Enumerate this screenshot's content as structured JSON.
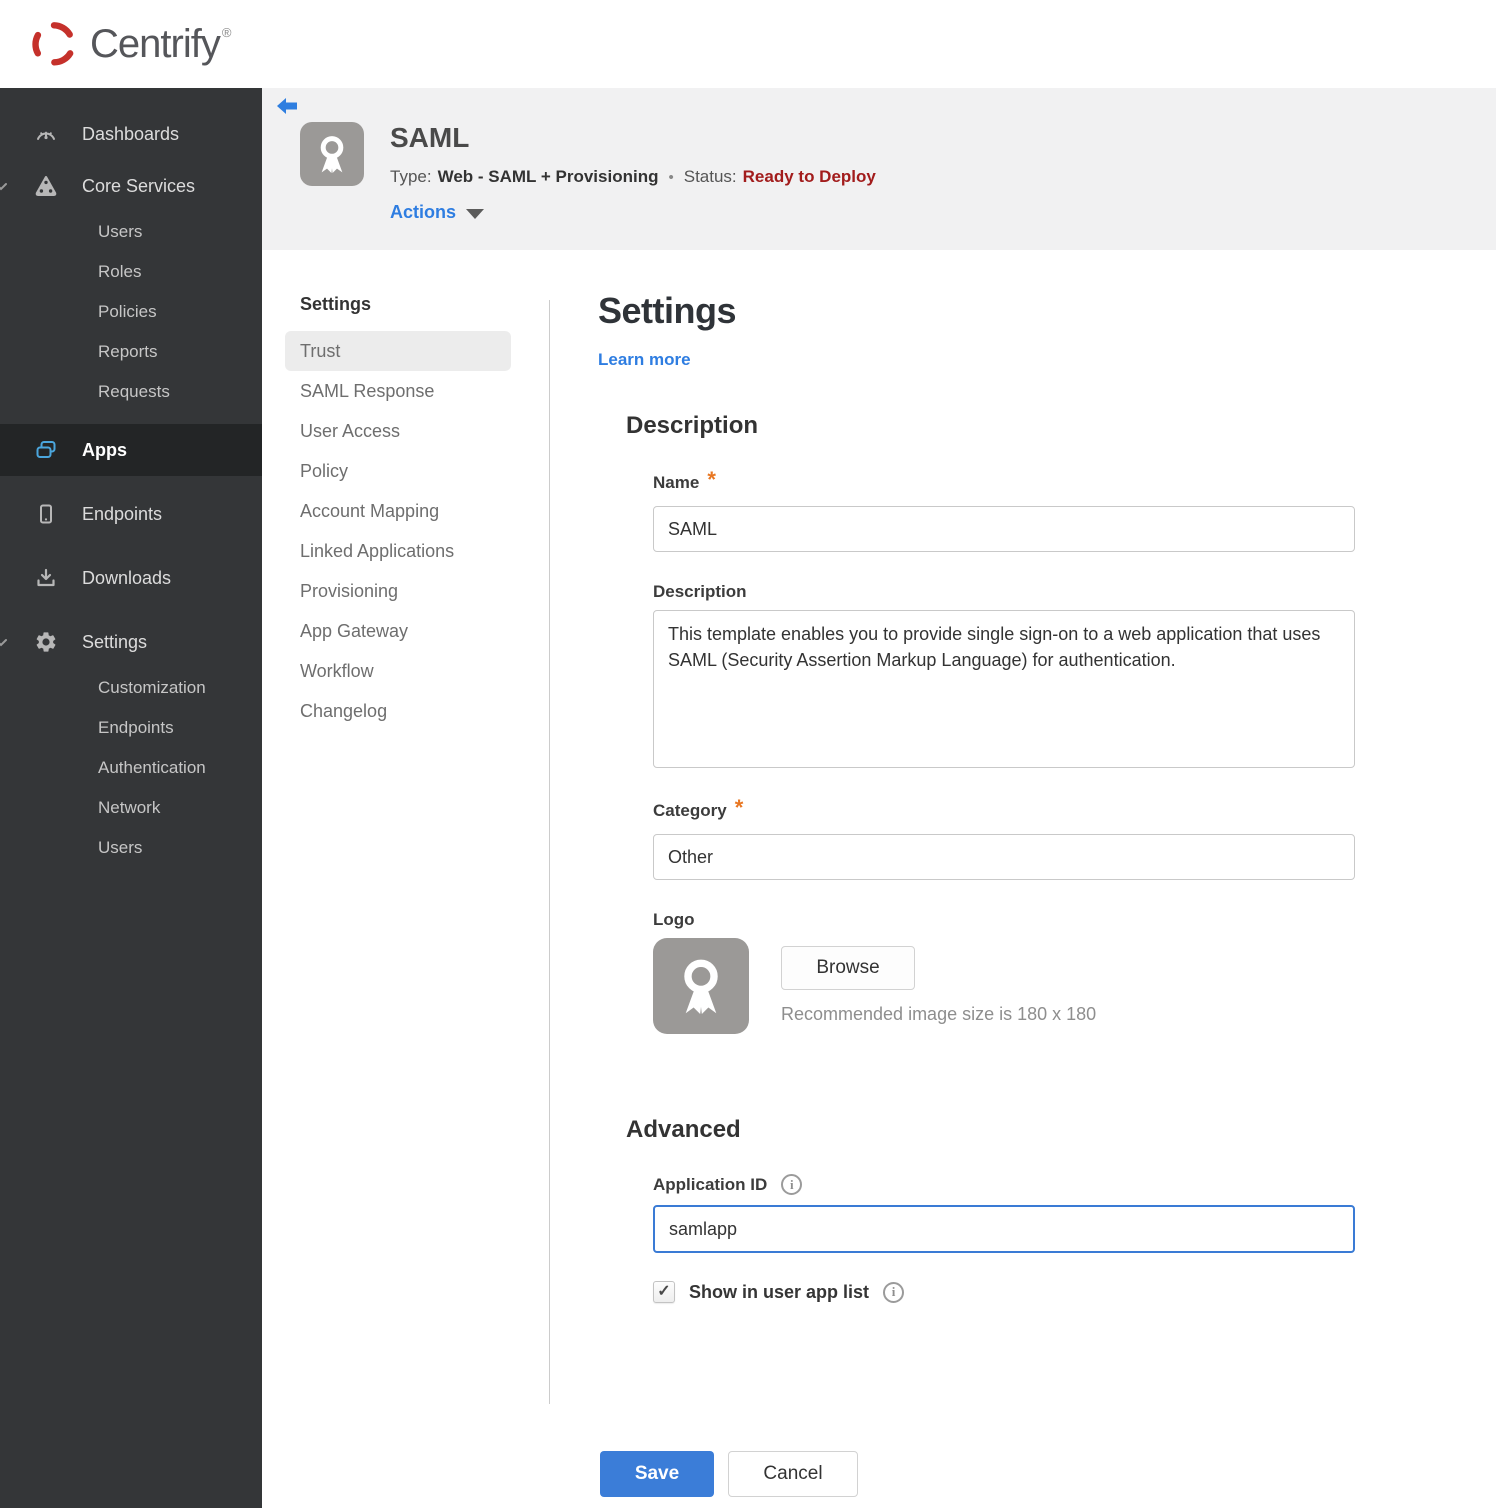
{
  "brand": {
    "name": "Centrify",
    "trademark": "®"
  },
  "colors": {
    "accent_blue": "#2e7de1",
    "save_blue": "#3b7dd8",
    "status_red": "#a21c1c",
    "brand_red": "#c5312b",
    "required_orange": "#e87722",
    "sidebar_bg": "#343638",
    "sidebar_active_bg": "#232526",
    "header_bg": "#f1f1f2"
  },
  "sidebar": {
    "dashboards": "Dashboards",
    "core_services": "Core Services",
    "core_services_items": [
      "Users",
      "Roles",
      "Policies",
      "Reports",
      "Requests"
    ],
    "apps": "Apps",
    "endpoints": "Endpoints",
    "downloads": "Downloads",
    "settings": "Settings",
    "settings_items": [
      "Customization",
      "Endpoints",
      "Authentication",
      "Network",
      "Users"
    ]
  },
  "header": {
    "title": "SAML",
    "type_label": "Type:",
    "type_value": "Web - SAML + Provisioning",
    "separator": "•",
    "status_label": "Status:",
    "status_value": "Ready to Deploy",
    "actions_label": "Actions"
  },
  "subnav": {
    "heading": "Settings",
    "selected": "Trust",
    "items": [
      "Trust",
      "SAML Response",
      "User Access",
      "Policy",
      "Account Mapping",
      "Linked Applications",
      "Provisioning",
      "App Gateway",
      "Workflow",
      "Changelog"
    ]
  },
  "main": {
    "title": "Settings",
    "learn_more": "Learn more",
    "description_section": {
      "heading": "Description",
      "name_label": "Name",
      "required_mark": "*",
      "name_value": "SAML",
      "description_label": "Description",
      "description_value": "This template enables you to provide single sign-on to a web application that uses SAML (Security Assertion Markup Language) for authentication.",
      "category_label": "Category",
      "category_value": "Other",
      "logo_label": "Logo",
      "browse_button": "Browse",
      "logo_hint": "Recommended image size is 180 x 180"
    },
    "advanced_section": {
      "heading": "Advanced",
      "app_id_label": "Application ID",
      "info_glyph": "i",
      "app_id_value": "samlapp",
      "check_glyph": "✓",
      "show_in_list_label": "Show in user app list"
    },
    "save_button": "Save",
    "cancel_button": "Cancel"
  }
}
